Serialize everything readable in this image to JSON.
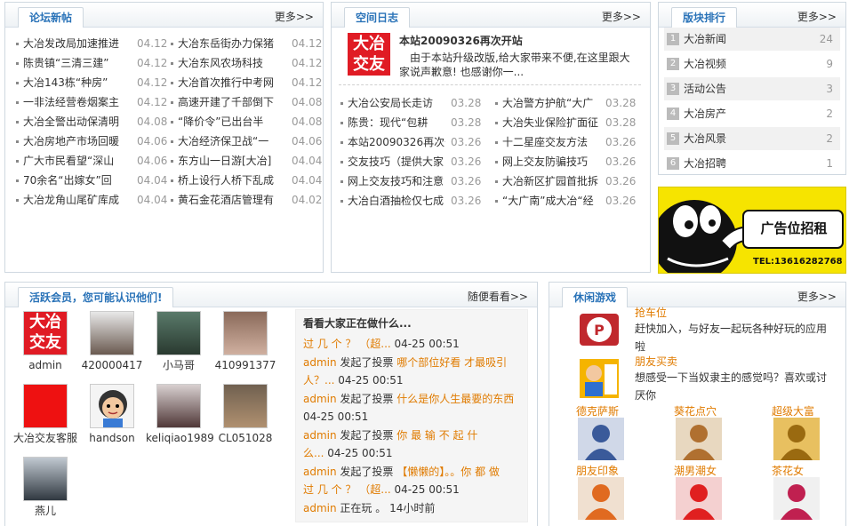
{
  "forum": {
    "title": "论坛新帖",
    "more": "更多>>",
    "left": [
      {
        "title": "大冶发改局加速推进",
        "date": "04.12"
      },
      {
        "title": "陈贵镇“三清三建”",
        "date": "04.12"
      },
      {
        "title": "大冶143栋“种房”",
        "date": "04.12"
      },
      {
        "title": "一非法经营卷烟案主",
        "date": "04.12"
      },
      {
        "title": "大冶全警出动保清明",
        "date": "04.08"
      },
      {
        "title": "大冶房地产市场回暖",
        "date": "04.06"
      },
      {
        "title": "广大市民看望“深山",
        "date": "04.06"
      },
      {
        "title": "70余名“出嫁女”回",
        "date": "04.04"
      },
      {
        "title": "大冶龙角山尾矿库成",
        "date": "04.04"
      }
    ],
    "right": [
      {
        "title": "大冶东岳街办力保猪",
        "date": "04.12"
      },
      {
        "title": "大冶东风农场科技",
        "date": "04.12"
      },
      {
        "title": "大冶首次推行中考网",
        "date": "04.12"
      },
      {
        "title": "高速开建了千部倒下",
        "date": "04.08"
      },
      {
        "title": "“降价令”已出台半",
        "date": "04.08"
      },
      {
        "title": "大冶经济保卫战“一",
        "date": "04.06"
      },
      {
        "title": "东方山一日游[大冶]",
        "date": "04.04"
      },
      {
        "title": "桥上设行人桥下乱成",
        "date": "04.04"
      },
      {
        "title": "黄石金花酒店管理有",
        "date": "04.02"
      }
    ]
  },
  "blog": {
    "title": "空间日志",
    "more": "更多>>",
    "logo_line1": "大冶",
    "logo_line2": "交友",
    "featured_title": "本站20090326再次开站",
    "featured_desc": "由于本站升级改版,给大家带来不便,在这里跟大家说声歉意! 也感谢你一...",
    "left": [
      {
        "title": "大冶公安局长走访",
        "date": "03.28"
      },
      {
        "title": "陈贵：现代“包耕",
        "date": "03.28"
      },
      {
        "title": "本站20090326再次开",
        "date": "03.26"
      },
      {
        "title": "交友技巧（提供大家",
        "date": "03.26"
      },
      {
        "title": "网上交友技巧和注意",
        "date": "03.26"
      },
      {
        "title": "大冶白酒抽检仅七成",
        "date": "03.26"
      }
    ],
    "right": [
      {
        "title": "大冶警方护航“大广",
        "date": "03.28"
      },
      {
        "title": "大冶失业保险扩面征",
        "date": "03.28"
      },
      {
        "title": "十二星座交友方法",
        "date": "03.26"
      },
      {
        "title": "网上交友防骗技巧",
        "date": "03.26"
      },
      {
        "title": "大冶新区扩园首批拆",
        "date": "03.26"
      },
      {
        "title": "“大广南”成大冶“经",
        "date": "03.26"
      }
    ]
  },
  "ranking": {
    "title": "版块排行",
    "more": "更多>>",
    "items": [
      {
        "num": "1",
        "name": "大冶新闻",
        "count": "24"
      },
      {
        "num": "2",
        "name": "大冶视频",
        "count": "9"
      },
      {
        "num": "3",
        "name": "活动公告",
        "count": "3"
      },
      {
        "num": "4",
        "name": "大冶房产",
        "count": "2"
      },
      {
        "num": "5",
        "name": "大冶风景",
        "count": "2"
      },
      {
        "num": "6",
        "name": "大冶招聘",
        "count": "1"
      }
    ]
  },
  "ad": {
    "text": "广告位招租",
    "tel": "TEL:13616282768"
  },
  "members": {
    "title": "活跃会员，您可能认识他们!",
    "more": "随便看看>>",
    "logo_line1": "大冶",
    "logo_line2": "交友",
    "items": [
      {
        "name": "admin"
      },
      {
        "name": "420000417"
      },
      {
        "name": "小马哥"
      },
      {
        "name": "410991377"
      },
      {
        "name": "大冶交友客服"
      },
      {
        "name": "handson"
      },
      {
        "name": "keliqiao1989"
      },
      {
        "name": "CL051028"
      },
      {
        "name": "燕儿"
      }
    ]
  },
  "activity": {
    "heading": "看看大家正在做什么...",
    "items": [
      {
        "lines": [
          {
            "actor": "",
            "verb": "",
            "link": "过 几 个 ？ （超...",
            "time": " 04-25 00:51"
          }
        ]
      },
      {
        "lines": [
          {
            "actor": "admin",
            "verb": " 发起了投票 ",
            "link": "哪个部位好看 才最吸引",
            "time": ""
          },
          {
            "actor": "",
            "verb": "",
            "link": "人？...",
            "time": " 04-25 00:51"
          }
        ]
      },
      {
        "lines": [
          {
            "actor": "admin",
            "verb": " 发起了投票 ",
            "link": "什么是你人生最要的东西",
            "time": ""
          },
          {
            "actor": "",
            "verb": "",
            "link": "",
            "time": "04-25 00:51"
          }
        ]
      },
      {
        "lines": [
          {
            "actor": "admin",
            "verb": " 发起了投票 ",
            "link": "你 最 输 不 起 什",
            "time": ""
          },
          {
            "actor": "",
            "verb": "",
            "link": "么...",
            "time": " 04-25 00:51"
          }
        ]
      },
      {
        "lines": [
          {
            "actor": "admin",
            "verb": " 发起了投票 ",
            "link": "【懒懒的】。。你 都 做",
            "time": ""
          },
          {
            "actor": "",
            "verb": "",
            "link": "过 几 个 ？ （超...",
            "time": " 04-25 00:51"
          }
        ]
      },
      {
        "lines": [
          {
            "actor": "admin",
            "verb": " 正在玩 ",
            "link": "",
            "time": "。 14小时前"
          }
        ]
      }
    ]
  },
  "games": {
    "title": "休闲游戏",
    "more": "更多>>",
    "featured": [
      {
        "name": "抢车位",
        "desc": "赶快加入，与好友一起玩各种好玩的应用啦",
        "icon": "parking-icon"
      },
      {
        "name": "朋友买卖",
        "desc": "想感受一下当奴隶主的感觉吗？喜欢或讨厌你",
        "icon": "friends-trade-icon"
      }
    ],
    "grid": [
      {
        "name": "德克萨斯",
        "icon": "poker-icon"
      },
      {
        "name": "葵花点穴",
        "icon": "acupoint-icon"
      },
      {
        "name": "超级大富",
        "icon": "rich-icon"
      },
      {
        "name": "朋友印象",
        "icon": "impression-icon"
      },
      {
        "name": "潮男潮女",
        "icon": "fashion-icon"
      },
      {
        "name": "茶花女",
        "icon": "camellia-icon"
      }
    ]
  }
}
